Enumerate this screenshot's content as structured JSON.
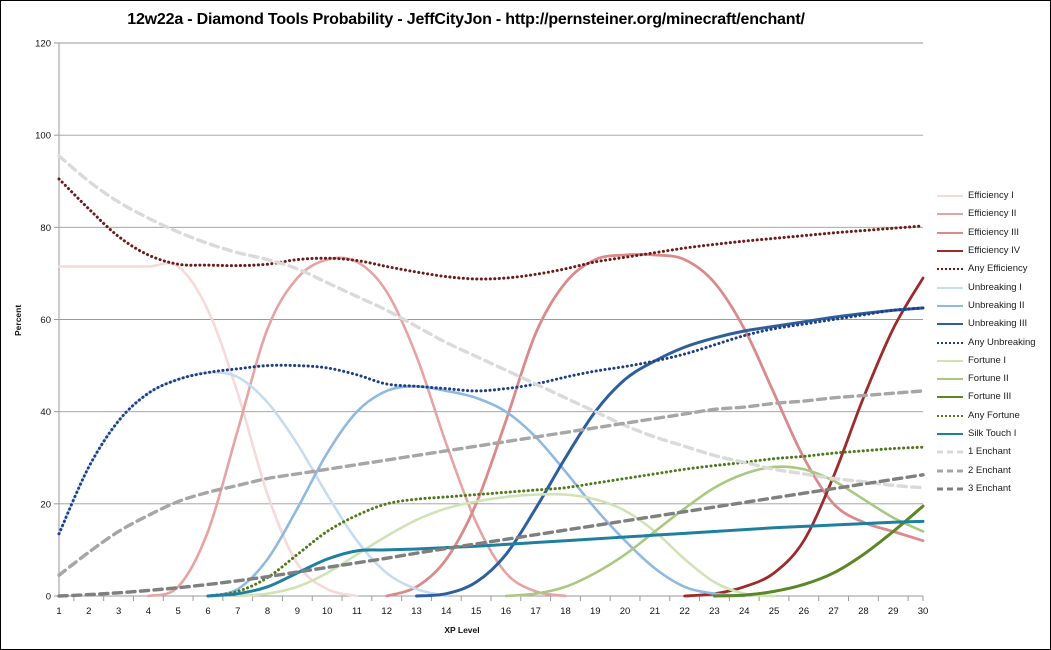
{
  "chart_data": {
    "type": "line",
    "title": "12w22a - Diamond Tools Probability - JeffCityJon - http://pernsteiner.org/minecraft/enchant/",
    "xlabel": "XP Level",
    "ylabel": "Percent",
    "xlim": [
      1,
      30
    ],
    "ylim": [
      0,
      120
    ],
    "yticks": [
      0,
      20,
      40,
      60,
      80,
      100,
      120
    ],
    "grid": "horizontal",
    "legend_position": "right",
    "x": [
      1,
      2,
      3,
      4,
      5,
      6,
      7,
      8,
      9,
      10,
      11,
      12,
      13,
      14,
      15,
      16,
      17,
      18,
      19,
      20,
      21,
      22,
      23,
      24,
      25,
      26,
      27,
      28,
      29,
      30
    ],
    "categories": [
      "1",
      "2",
      "3",
      "4",
      "5",
      "6",
      "7",
      "8",
      "9",
      "10",
      "11",
      "12",
      "13",
      "14",
      "15",
      "16",
      "17",
      "18",
      "19",
      "20",
      "21",
      "22",
      "23",
      "24",
      "25",
      "26",
      "27",
      "28",
      "29",
      "30"
    ],
    "series": [
      {
        "name": "Efficiency I",
        "color": "#f6d9d9",
        "style": "solid",
        "width": 2.6,
        "values": [
          71.5,
          71.5,
          71.5,
          71.5,
          71.5,
          62,
          44,
          22,
          7,
          1.5,
          0,
          0,
          0,
          0,
          0,
          0,
          0,
          0,
          0,
          0,
          0,
          0,
          0,
          0,
          0,
          0,
          0,
          0,
          0,
          0
        ]
      },
      {
        "name": "Efficiency II",
        "color": "#e6a3a3",
        "style": "solid",
        "width": 2.6,
        "values": [
          0,
          0,
          0,
          0,
          2,
          14,
          36,
          58,
          69,
          73,
          72.5,
          66,
          52,
          33,
          16,
          5,
          1,
          0,
          0,
          0,
          0,
          0,
          0,
          0,
          0,
          0,
          0,
          0,
          0,
          0
        ]
      },
      {
        "name": "Efficiency III",
        "color": "#d98a8a",
        "style": "solid",
        "width": 2.8,
        "values": [
          0,
          0,
          0,
          0,
          0,
          0,
          0,
          0,
          0,
          0,
          0,
          0,
          2,
          8,
          20,
          38,
          57,
          68,
          73,
          74,
          74,
          73,
          68,
          58,
          44,
          30,
          20,
          16,
          14,
          12
        ]
      },
      {
        "name": "Efficiency IV",
        "color": "#9c2b2b",
        "style": "solid",
        "width": 2.8,
        "values": [
          0,
          0,
          0,
          0,
          0,
          0,
          0,
          0,
          0,
          0,
          0,
          0,
          0,
          0,
          0,
          0,
          0,
          0,
          0,
          0,
          0,
          0,
          0.5,
          2,
          5,
          12,
          26,
          43,
          58,
          69
        ]
      },
      {
        "name": "Any Efficiency",
        "color": "#6d1a1a",
        "style": "dotted",
        "width": 3.0,
        "values": [
          90.5,
          84,
          78,
          74,
          72,
          71.8,
          71.7,
          72,
          73,
          73.3,
          72.8,
          71.5,
          70.3,
          69.3,
          68.8,
          69,
          69.8,
          71,
          72.5,
          73.5,
          74.5,
          75.5,
          76.3,
          77,
          77.6,
          78.2,
          78.8,
          79.3,
          79.8,
          80.3
        ]
      },
      {
        "name": "Unbreaking I",
        "color": "#c5dcf0",
        "style": "solid",
        "width": 2.6,
        "values": [
          13.5,
          28,
          38,
          44,
          47,
          48.5,
          47.5,
          42,
          33,
          22,
          12,
          5,
          1.5,
          0,
          0,
          0,
          0,
          0,
          0,
          0,
          0,
          0,
          0,
          0,
          0,
          0,
          0,
          0,
          0,
          0
        ]
      },
      {
        "name": "Unbreaking II",
        "color": "#8fb9e0",
        "style": "solid",
        "width": 2.6,
        "values": [
          0,
          0,
          0,
          0,
          0,
          0,
          1.5,
          8,
          19,
          31,
          40,
          44.5,
          45.5,
          44.5,
          43,
          40,
          34.5,
          27,
          19,
          12,
          6,
          2,
          0.5,
          0,
          0,
          0,
          0,
          0,
          0,
          0
        ]
      },
      {
        "name": "Unbreaking III",
        "color": "#2e5f9d",
        "style": "solid",
        "width": 3.0,
        "values": [
          0,
          0,
          0,
          0,
          0,
          0,
          0,
          0,
          0,
          0,
          0,
          0,
          0,
          0.5,
          3,
          9,
          19,
          30,
          40,
          47,
          51,
          54,
          56,
          57.5,
          58.5,
          59.5,
          60.5,
          61.3,
          62,
          62.5
        ]
      },
      {
        "name": "Any Unbreaking",
        "color": "#1f3f85",
        "style": "dotted",
        "width": 3.0,
        "values": [
          13.5,
          28,
          38,
          44,
          47,
          48.5,
          49.3,
          50,
          50,
          49.5,
          48,
          46,
          45.5,
          45,
          44.5,
          45,
          46,
          47.5,
          48.8,
          49.8,
          51,
          52.5,
          54.5,
          56.5,
          58,
          59,
          60,
          61,
          62,
          62.5
        ]
      },
      {
        "name": "Fortune I",
        "color": "#cfe3b5",
        "style": "solid",
        "width": 2.6,
        "values": [
          0,
          0,
          0,
          0,
          0,
          0,
          0,
          0.5,
          2,
          5,
          9,
          13,
          16.5,
          19,
          20.5,
          21.5,
          22,
          22,
          21,
          18.5,
          14,
          8,
          3,
          0.5,
          0,
          0,
          0,
          0,
          0,
          0
        ]
      },
      {
        "name": "Fortune II",
        "color": "#a9c882",
        "style": "solid",
        "width": 2.6,
        "values": [
          0,
          0,
          0,
          0,
          0,
          0,
          0,
          0,
          0,
          0,
          0,
          0,
          0,
          0,
          0,
          0,
          0.5,
          2,
          5,
          9,
          14,
          19,
          23.5,
          26.5,
          28,
          27.5,
          25,
          21,
          17,
          14
        ]
      },
      {
        "name": "Fortune III",
        "color": "#5c8727",
        "style": "solid",
        "width": 3.0,
        "values": [
          0,
          0,
          0,
          0,
          0,
          0,
          0,
          0,
          0,
          0,
          0,
          0,
          0,
          0,
          0,
          0,
          0,
          0,
          0,
          0,
          0,
          0,
          0,
          0.2,
          1,
          2.5,
          5,
          9,
          14,
          19.5
        ]
      },
      {
        "name": "Any Fortune",
        "color": "#4e7a1e",
        "style": "dotted",
        "width": 3.0,
        "values": [
          0,
          0,
          0,
          0,
          0,
          0,
          1,
          4,
          9,
          14,
          17.5,
          20,
          21,
          21.5,
          22,
          22.5,
          23,
          23.5,
          24.5,
          25.5,
          26.5,
          27.5,
          28.3,
          29,
          29.8,
          30.3,
          31,
          31.5,
          32,
          32.3
        ]
      },
      {
        "name": "Silk Touch I",
        "color": "#1e7f9e",
        "style": "solid",
        "width": 3.0,
        "values": [
          0,
          0,
          0,
          0,
          0,
          0,
          0.5,
          2,
          5,
          8,
          9.8,
          10,
          10.2,
          10.5,
          10.8,
          11.2,
          11.6,
          12,
          12.4,
          12.8,
          13.2,
          13.6,
          14,
          14.4,
          14.8,
          15.1,
          15.4,
          15.7,
          16,
          16.2
        ]
      },
      {
        "name": "1 Enchant",
        "color": "#dadada",
        "style": "dashed",
        "width": 3.4,
        "values": [
          95.5,
          90,
          85.5,
          82,
          79,
          76.5,
          74.5,
          73,
          71,
          68,
          65,
          62,
          58.5,
          55,
          52,
          49,
          46,
          43,
          40,
          37,
          34.5,
          32.5,
          30.5,
          29,
          27.5,
          26.5,
          25.5,
          24.8,
          24,
          23.5
        ]
      },
      {
        "name": "2 Enchant",
        "color": "#a6a6a6",
        "style": "dashed",
        "width": 3.4,
        "values": [
          4.5,
          9.5,
          14,
          17.5,
          20.5,
          22.5,
          24,
          25.5,
          26.5,
          27.5,
          28.5,
          29.5,
          30.5,
          31.5,
          32.5,
          33.5,
          34.5,
          35.5,
          36.5,
          37.5,
          38.5,
          39.5,
          40.5,
          41,
          41.8,
          42.3,
          43,
          43.5,
          44,
          44.5
        ]
      },
      {
        "name": "3 Enchant",
        "color": "#7f7f7f",
        "style": "dashed",
        "width": 3.4,
        "values": [
          0,
          0.3,
          0.7,
          1.2,
          1.8,
          2.5,
          3.3,
          4.2,
          5.2,
          6.2,
          7.2,
          8.2,
          9.3,
          10.3,
          11.3,
          12.3,
          13.3,
          14.3,
          15.3,
          16.3,
          17.3,
          18.3,
          19.3,
          20.3,
          21.3,
          22.3,
          23.3,
          24.3,
          25.3,
          26.3
        ]
      }
    ]
  }
}
